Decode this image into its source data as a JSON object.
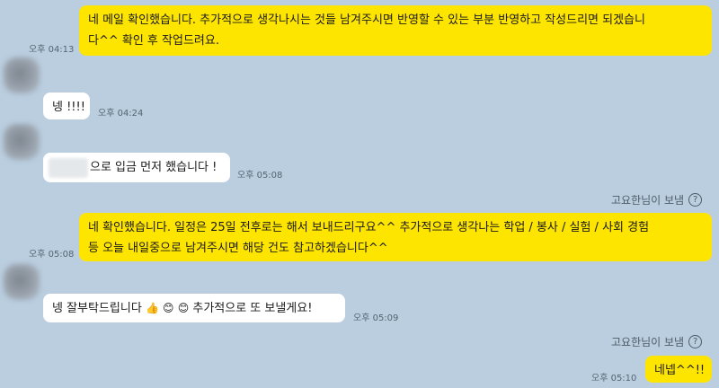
{
  "messages": [
    {
      "id": "m1",
      "from": "me",
      "lines": [
        "네 메일 확인했습니다. 추가적으로 생각나시는 것들 남겨주시면 반영할 수 있는 부분 반영하고 작성드리면 되겠습니",
        "다^^ 확인 후 작업드려요."
      ],
      "time": "오후 04:13"
    },
    {
      "id": "m2",
      "from": "them",
      "text": "넹 !!!!",
      "time": "오후 04:24"
    },
    {
      "id": "m3",
      "from": "them",
      "text": "으로 입금 먼저 했습니다 !",
      "time": "오후 05:08"
    },
    {
      "id": "m4",
      "from": "me",
      "sender_note": "고요한님이 보냄",
      "lines": [
        "네 확인했습니다. 일정은 25일 전후로는 해서 보내드리구요^^ 추가적으로 생각나는 학업 / 봉사 / 실험 / 사회 경험",
        "등 오늘 내일중으로 남겨주시면 해당 건도 참고하겠습니다^^"
      ],
      "time": "오후 05:08"
    },
    {
      "id": "m5",
      "from": "them",
      "text_before": "넹 잘부탁드립니다",
      "emojis": [
        "👍",
        "😊",
        "😊"
      ],
      "text_after": "추가적으로 또 보낼게요!",
      "time": "오후 05:09"
    },
    {
      "id": "m6",
      "from": "me",
      "sender_note": "고요한님이 보냄",
      "text": "네넵^^!!",
      "time": "오후 05:10"
    }
  ],
  "icons": {
    "help": "question-circle-icon"
  },
  "colors": {
    "background": "#bacee0",
    "my_bubble": "#fee500",
    "their_bubble": "#ffffff"
  }
}
